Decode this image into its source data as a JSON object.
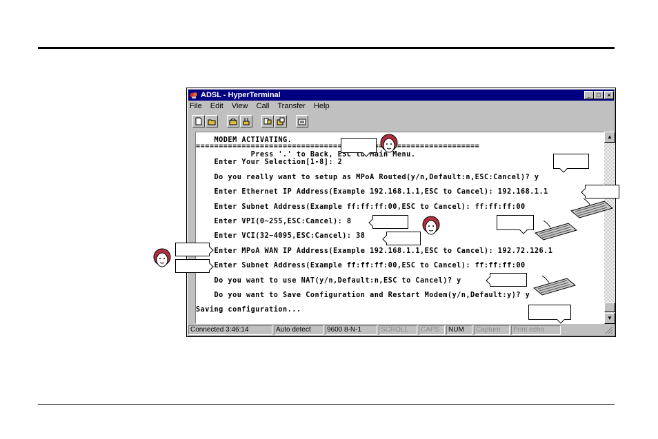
{
  "window": {
    "title": "ADSL - HyperTerminal",
    "controls": [
      "_",
      "□",
      "×"
    ]
  },
  "menu": [
    "File",
    "Edit",
    "View",
    "Call",
    "Transfer",
    "Help"
  ],
  "toolbar": [
    "new-icon",
    "open-icon",
    "phone-icon",
    "disconnect-icon",
    "send-icon",
    "receive-icon",
    "properties-icon"
  ],
  "terminal": {
    "lines": [
      "    MODEM ACTIVATING.",
      "==============================================================",
      "            Press '.' to Back, ESC to Main Menu.",
      "    Enter Your Selection[1-8]: 2",
      "",
      "    Do you really want to setup as MPoA Routed(y/n,Default:n,ESC:Cancel)? y",
      "",
      "    Enter Ethernet IP Address(Example 192.168.1.1,ESC to Cancel): 192.168.1.1",
      "",
      "    Enter Subnet Address(Example ff:ff:ff:00,ESC to Cancel): ff:ff:ff:00",
      "",
      "    Enter VPI(0~255,ESC:Cancel): 8",
      "",
      "    Enter VCI(32~4095,ESC:Cancel): 38",
      "",
      "    Enter MPoA WAN IP Address(Example 192.168.1.1,ESC to Cancel): 192.72.126.1",
      "",
      "    Enter Subnet Address(Example ff:ff:ff:00,ESC to Cancel): ff:ff:ff:00",
      "",
      "    Do you want to use NAT(y/n,Default:n,ESC to Cancel)? y",
      "",
      "    Do you want to Save Configuration and Restart Modem(y/n,Default:y)? y",
      "",
      "Saving configuration..."
    ]
  },
  "status": {
    "connected": "Connected 3:46:14",
    "detect": "Auto detect",
    "settings": "9600 8-N-1",
    "scroll": "SCROLL",
    "caps": "CAPS",
    "num": "NUM",
    "capture": "Capture",
    "print_echo": "Print echo"
  },
  "colors": {
    "titlebar": "#000080",
    "chrome": "#c0c0c0"
  }
}
